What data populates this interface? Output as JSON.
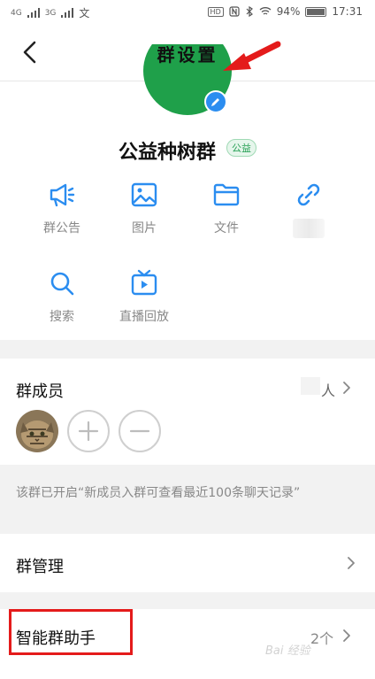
{
  "status_bar": {
    "sim1": "4G",
    "sim2": "3G",
    "app_glyph": "文",
    "battery": "94%",
    "time": "17:31"
  },
  "header": {
    "title": "群设置"
  },
  "group": {
    "name": "公益种树群",
    "tag": "公益"
  },
  "actions": [
    {
      "label": "群公告",
      "icon": "megaphone-icon"
    },
    {
      "label": "图片",
      "icon": "image-icon"
    },
    {
      "label": "文件",
      "icon": "folder-icon"
    },
    {
      "label": "",
      "icon": "link-icon"
    },
    {
      "label": "搜索",
      "icon": "search-icon"
    },
    {
      "label": "直播回放",
      "icon": "tv-icon"
    }
  ],
  "members": {
    "title": "群成员",
    "count_suffix": "人"
  },
  "notice": "该群已开启“新成员入群可查看最近100条聊天记录”",
  "manage": {
    "title": "群管理"
  },
  "helper": {
    "title": "智能群助手",
    "count": "2个"
  },
  "colors": {
    "accent": "#2b8df0",
    "highlight": "#e41b1b",
    "avatar_green": "#1fa04a"
  }
}
